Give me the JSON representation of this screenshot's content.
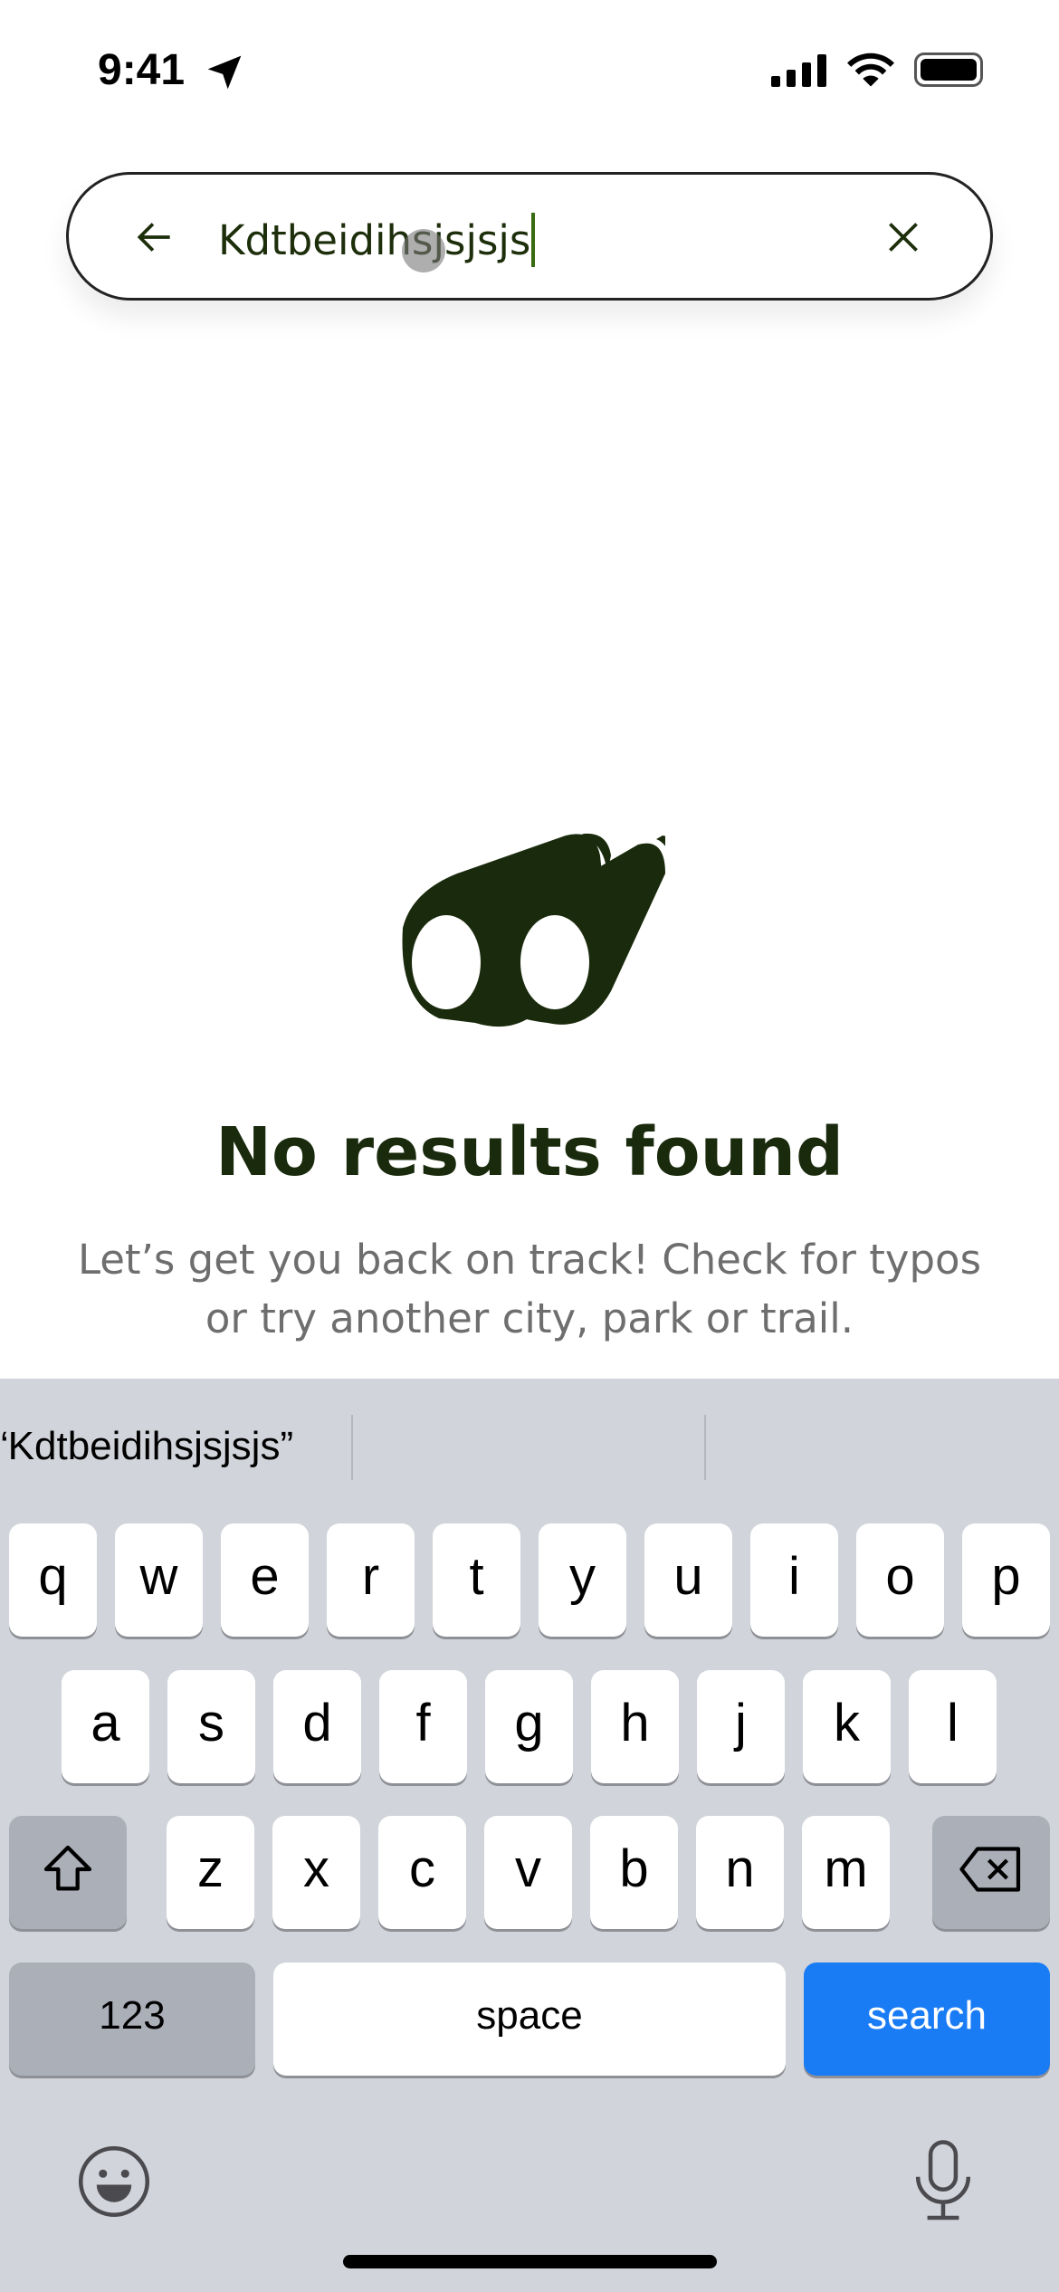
{
  "status_bar": {
    "time": "9:41"
  },
  "search": {
    "query": "Kdtbeidihsjsjsjs"
  },
  "empty_state": {
    "icon": "binoculars-icon",
    "title": "No results found",
    "subtitle_line1": "Let’s get you back on track! Check for typos",
    "subtitle_line2": "or try another city, park or trail."
  },
  "keyboard": {
    "suggestion": "“Kdtbeidihsjsjsjs”",
    "row1": [
      "q",
      "w",
      "e",
      "r",
      "t",
      "y",
      "u",
      "i",
      "o",
      "p"
    ],
    "row2": [
      "a",
      "s",
      "d",
      "f",
      "g",
      "h",
      "j",
      "k",
      "l"
    ],
    "row3": [
      "z",
      "x",
      "c",
      "v",
      "b",
      "n",
      "m"
    ],
    "numbers_label": "123",
    "space_label": "space",
    "search_label": "search"
  },
  "colors": {
    "accent": "#1a2a0c",
    "search_key": "#1a7cf5",
    "keyboard_bg": "#d1d4da"
  }
}
